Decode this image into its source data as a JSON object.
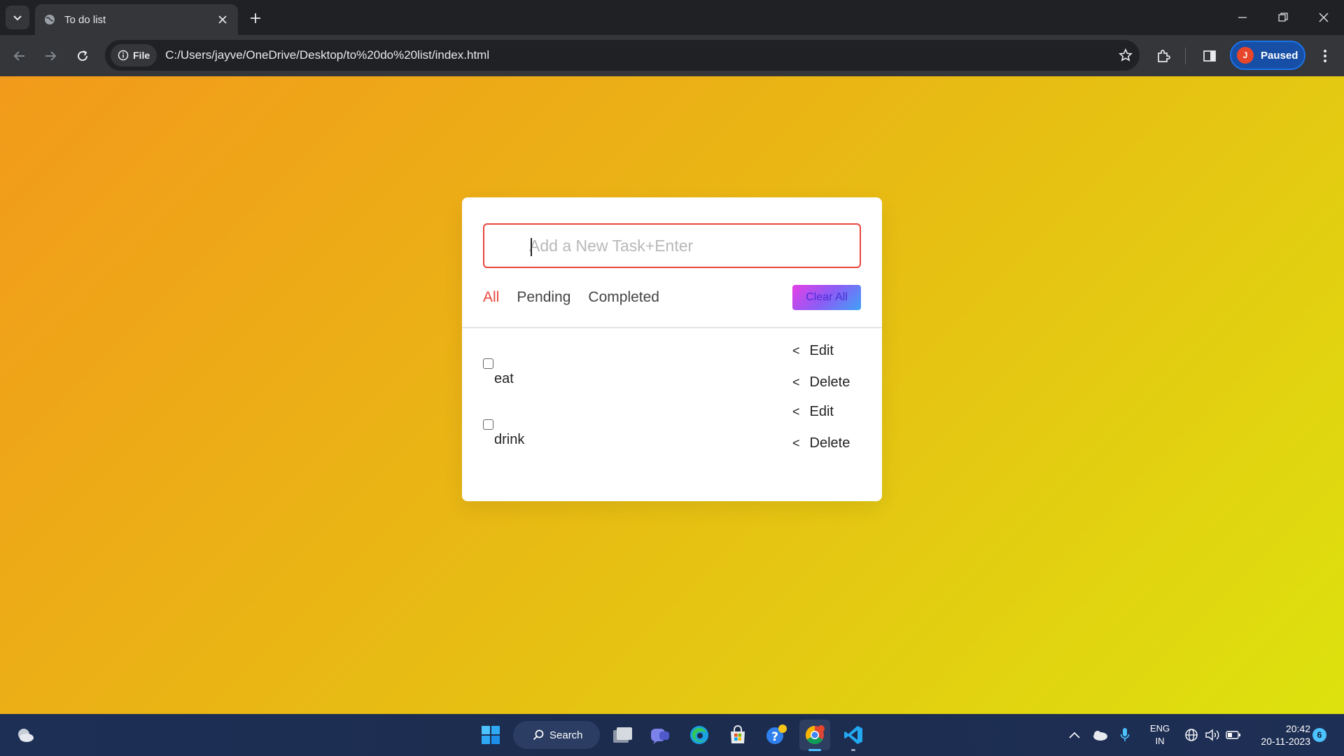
{
  "browser": {
    "tab_title": "To do list",
    "file_chip": "File",
    "url": "C:/Users/jayve/OneDrive/Desktop/to%20do%20list/index.html",
    "profile_initial": "J",
    "profile_status": "Paused"
  },
  "todo": {
    "input_placeholder": "Add a New Task+Enter",
    "filters": [
      {
        "label": "All",
        "active": true
      },
      {
        "label": "Pending",
        "active": false
      },
      {
        "label": "Completed",
        "active": false
      }
    ],
    "clear_label": "Clear All",
    "tasks": [
      {
        "name": "eat",
        "checked": false,
        "edit_label": "Edit",
        "delete_label": "Delete"
      },
      {
        "name": "drink",
        "checked": false,
        "edit_label": "Edit",
        "delete_label": "Delete"
      }
    ],
    "action_prefix": "<"
  },
  "taskbar": {
    "search_label": "Search",
    "lang_line1": "ENG",
    "lang_line2": "IN",
    "time": "20:42",
    "date": "20-11-2023",
    "notification_count": "6"
  },
  "colors": {
    "accent_active_filter": "#e8453c",
    "input_border": "#e8453c",
    "background_gradient_start": "#f29a1b",
    "background_gradient_end": "#dde20e",
    "chrome_dark": "#202124",
    "profile_blue": "#174ea6"
  }
}
